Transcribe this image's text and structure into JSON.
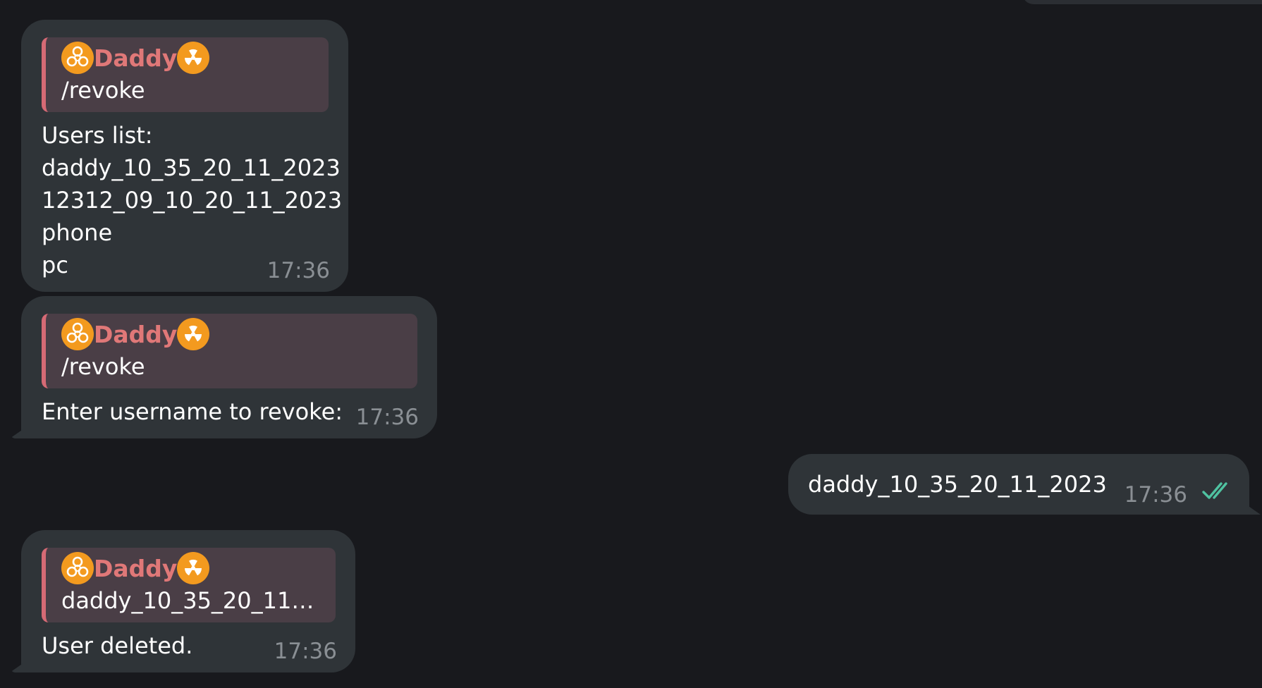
{
  "sender_name": "Daddy",
  "messages": [
    {
      "reply_name": "Daddy",
      "reply_text": "/revoke",
      "lines": [
        "Users list:",
        "daddy_10_35_20_11_2023",
        "12312_09_10_20_11_2023",
        "phone",
        "pc"
      ],
      "time": "17:36"
    },
    {
      "reply_name": "Daddy",
      "reply_text": "/revoke",
      "lines": [
        "Enter username to revoke:"
      ],
      "time": "17:36"
    },
    {
      "text": "daddy_10_35_20_11_2023",
      "time": "17:36",
      "read_icon": "double-check-icon"
    },
    {
      "reply_name": "Daddy",
      "reply_text": "daddy_10_35_20_11_...",
      "lines": [
        "User deleted."
      ],
      "time": "17:36"
    }
  ],
  "colors": {
    "background": "#18191d",
    "bubble": "#2f3438",
    "reply_bg": "#4a3e46",
    "reply_accent": "#d66a75",
    "sender_name": "#e07878",
    "time": "#8a8f94",
    "check": "#4fc3a1",
    "emoji": "#f39a1f"
  },
  "icons": {
    "left_emoji": "biohazard-icon",
    "right_emoji": "radioactive-icon"
  }
}
